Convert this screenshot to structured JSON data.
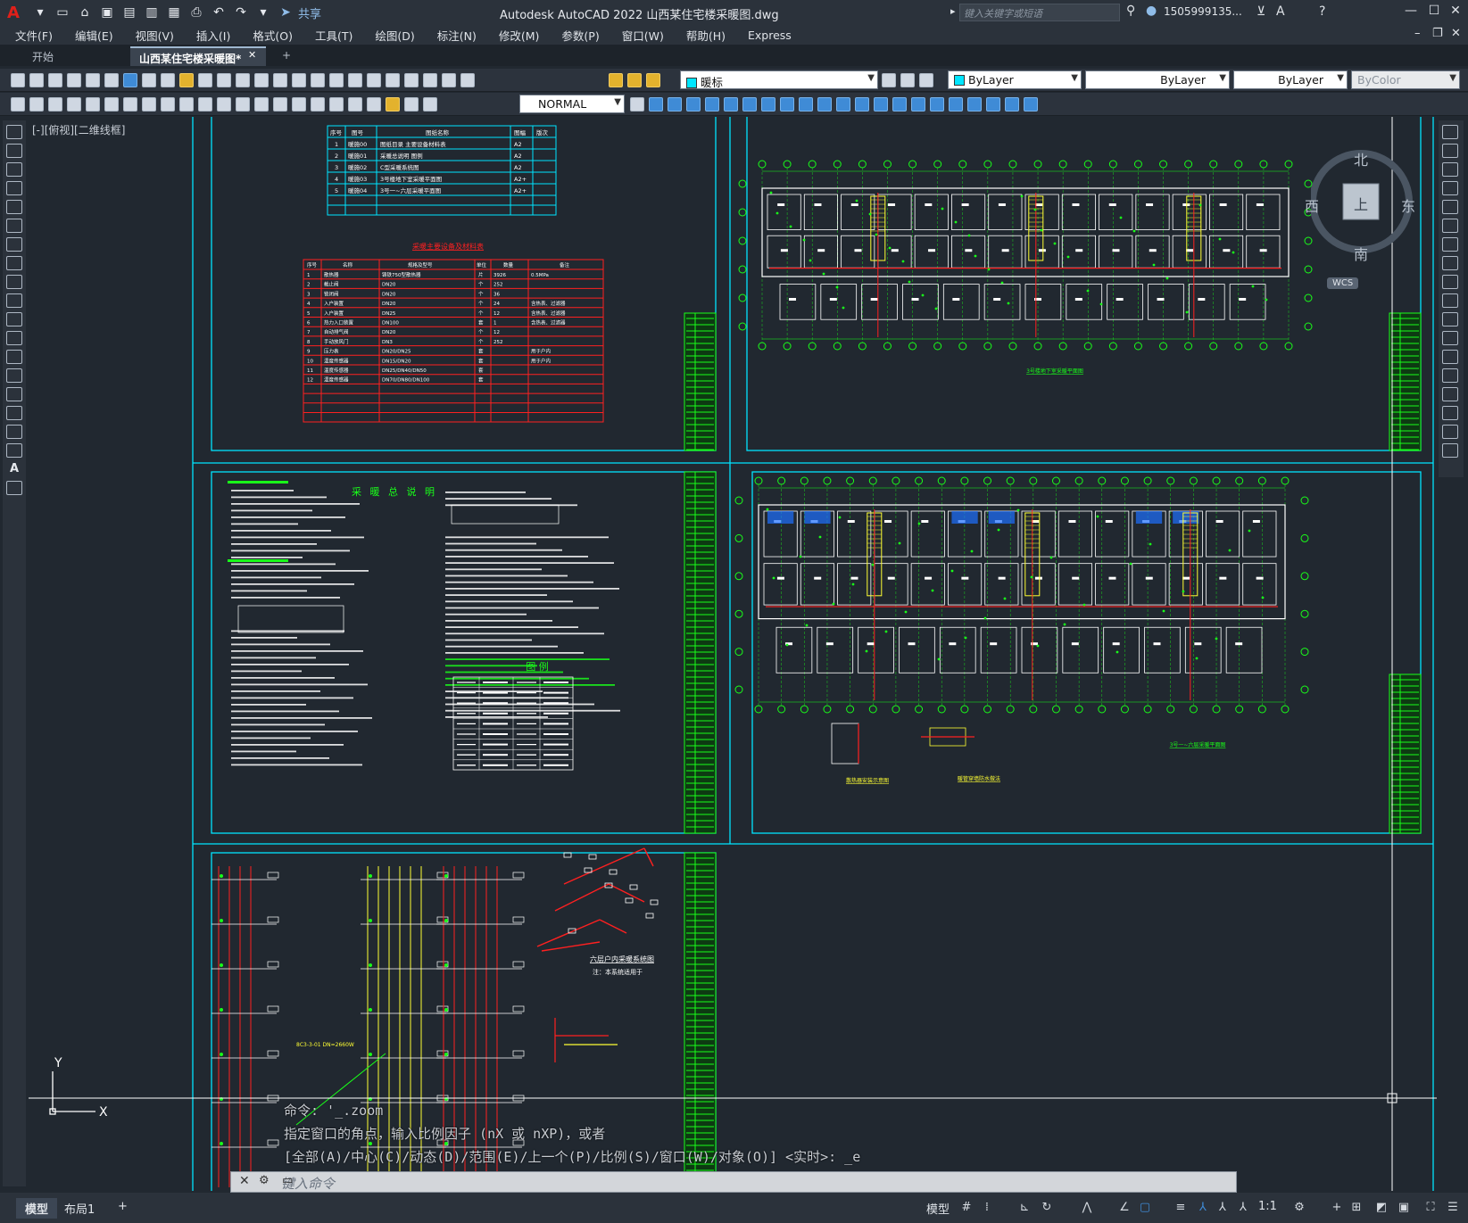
{
  "app": {
    "logo": "A",
    "title": "Autodesk AutoCAD 2022    山西某住宅楼采暖图.dwg",
    "share_label": "共享",
    "search_placeholder": "键入关键字或短语",
    "user": "1505999135...",
    "controls": {
      "minimize": "—",
      "maximize": "☐",
      "close": "✕"
    }
  },
  "menu": [
    "文件(F)",
    "编辑(E)",
    "视图(V)",
    "插入(I)",
    "格式(O)",
    "工具(T)",
    "绘图(D)",
    "标注(N)",
    "修改(M)",
    "参数(P)",
    "窗口(W)",
    "帮助(H)",
    "Express"
  ],
  "tabs": {
    "start": "开始",
    "active": "山西某住宅楼采暖图*",
    "add": "+"
  },
  "toolbar": {
    "layer": "暖标",
    "layer_color": "#00e5ff",
    "color": "ByLayer",
    "linetype": "ByLayer",
    "lineweight": "ByLayer",
    "plotstyle": "ByColor",
    "dimstyle": "NORMAL"
  },
  "canvas": {
    "viewport_label": "[-][俯视][二维线框]",
    "viewcube": {
      "north": "北",
      "south": "南",
      "east": "东",
      "west": "西",
      "top": "上",
      "wcs": "WCS"
    },
    "sheets": {
      "s1_drawing_list_headers": [
        "序号",
        "图号",
        "图纸名称",
        "图幅",
        "版次"
      ],
      "s1_drawing_list_rows": [
        [
          "1",
          "暖施00",
          "图纸目录   主要设备材料表",
          "A2",
          ""
        ],
        [
          "2",
          "暖施01",
          "采暖总说明  图例",
          "A2",
          ""
        ],
        [
          "3",
          "暖施02",
          "C型采暖系统图",
          "A2",
          ""
        ],
        [
          "4",
          "暖施03",
          "3号楼地下室采暖平面图",
          "A2+",
          ""
        ],
        [
          "5",
          "暖施04",
          "3号一~六层采暖平面图",
          "A2+",
          ""
        ]
      ],
      "s1_material_title": "采暖主要设备及材料表",
      "s1_material_headers": [
        "序号",
        "名称",
        "规格及型号",
        "单位",
        "数量",
        "备注"
      ],
      "s1_material_rows": [
        [
          "1",
          "散热器",
          "铸铁750型散热器",
          "片",
          "3926",
          "0.5MPa"
        ],
        [
          "2",
          "截止阀",
          "DN20",
          "个",
          "252",
          ""
        ],
        [
          "3",
          "锁闭阀",
          "DN20",
          "个",
          "36",
          ""
        ],
        [
          "4",
          "入户装置",
          "DN20",
          "个",
          "24",
          "含热表、过滤器"
        ],
        [
          "5",
          "入户装置",
          "DN25",
          "个",
          "12",
          "含热表、过滤器"
        ],
        [
          "6",
          "热力入口装置",
          "DN100",
          "套",
          "1",
          "含热表、过滤器"
        ],
        [
          "7",
          "自动排气阀",
          "DN20",
          "个",
          "12",
          ""
        ],
        [
          "8",
          "手动放风门",
          "DN3",
          "个",
          "252",
          ""
        ],
        [
          "9",
          "压力表",
          "DN20/DN25",
          "套",
          "",
          "用于户内"
        ],
        [
          "10",
          "温度传感器",
          "DN15/DN20",
          "套",
          "",
          "用于户内"
        ],
        [
          "11",
          "温度传感器",
          "DN25/DN40/DN50",
          "套",
          "",
          ""
        ],
        [
          "12",
          "温度传感器",
          "DN70/DN80/DN100",
          "套",
          "",
          ""
        ]
      ],
      "s2_title": "3号楼地下室采暖平面图",
      "s3_title": "采 暖 总 说 明",
      "s3_legend_title": "图 例",
      "s4_title": "3号一~六层采暖平面图",
      "s4_detail1": "散热器安装示意图",
      "s4_detail2": "暖管穿墙防水做法",
      "s5_title": "六层户内采暖系统图",
      "s5_subtitle": "注：本系统适用于",
      "s5_label": "8C3-3-01 DN=2660W"
    }
  },
  "command": {
    "history": [
      "命令: '_.zoom",
      "指定窗口的角点，输入比例因子 (nX 或 nXP)，或者",
      "[全部(A)/中心(C)/动态(D)/范围(E)/上一个(P)/比例(S)/窗口(W)/对象(O)] <实时>: _e"
    ],
    "placeholder": "键入命令"
  },
  "status": {
    "model_tab": "模型",
    "layout_tab": "布局1",
    "add_tab": "+",
    "mode": "模型",
    "scale": "1:1"
  },
  "colors": {
    "frame": "#00e5ff",
    "table_red": "#ff2020",
    "green": "#19ff19",
    "yellow": "#ffff33",
    "accent_blue": "#1e6fff"
  }
}
